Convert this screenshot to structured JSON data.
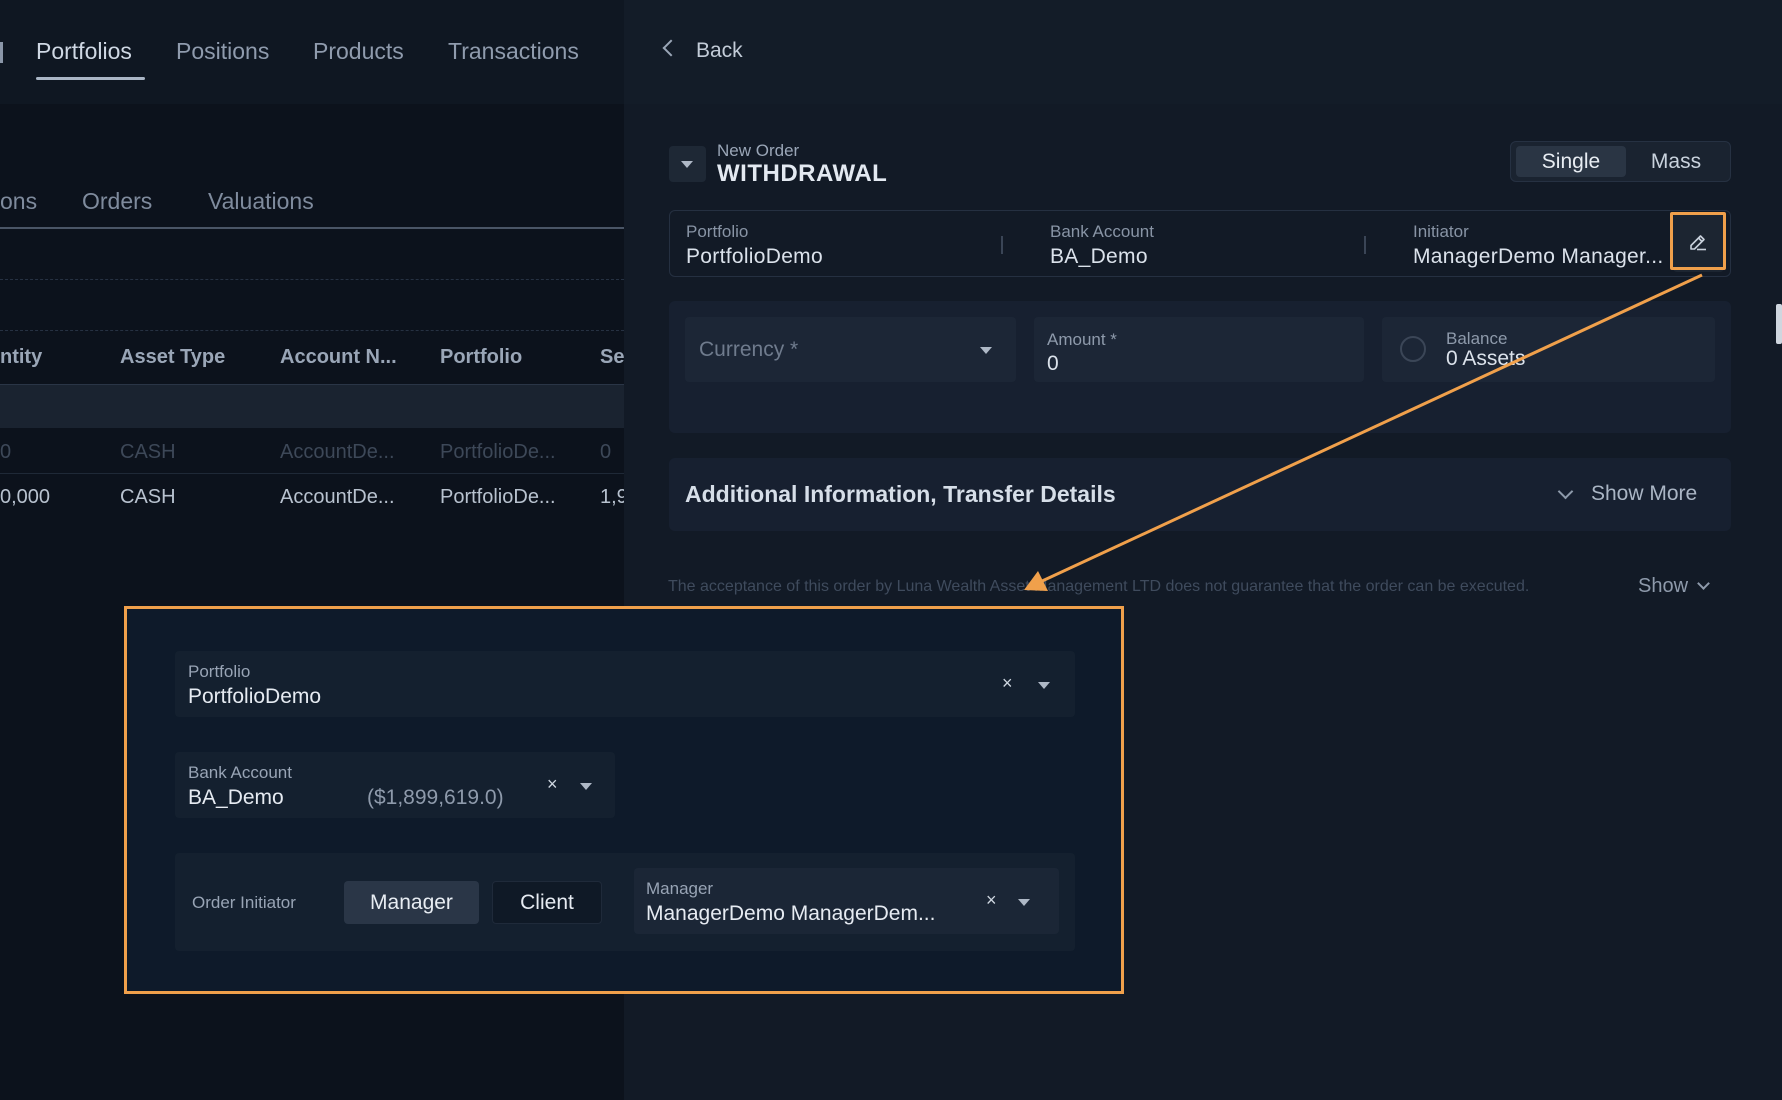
{
  "left_app": {
    "nav_tabs": [
      "Portfolios",
      "Positions",
      "Products",
      "Transactions"
    ],
    "active_nav": "Portfolios",
    "sub_tabs": [
      "ons",
      "Orders",
      "Valuations"
    ],
    "table": {
      "headers": [
        "ntity",
        "Asset Type",
        "Account N...",
        "Portfolio",
        "Se"
      ],
      "rows": [
        [
          "0",
          "CASH",
          "AccountDe...",
          "PortfolioDe...",
          "0"
        ],
        [
          "0,000",
          "CASH",
          "AccountDe...",
          "PortfolioDe...",
          "1,9"
        ]
      ]
    }
  },
  "order_panel": {
    "back_label": "Back",
    "kicker": "New Order",
    "title": "WITHDRAWAL",
    "mode_options": [
      "Single",
      "Mass"
    ],
    "active_mode": "Single",
    "summary": {
      "portfolio_label": "Portfolio",
      "portfolio_value": "PortfolioDemo",
      "bank_label": "Bank Account",
      "bank_value": "BA_Demo",
      "initiator_label": "Initiator",
      "initiator_value": "ManagerDemo Manager..."
    },
    "fields": {
      "currency_placeholder": "Currency *",
      "amount_label": "Amount *",
      "amount_value": "0",
      "balance_label": "Balance",
      "balance_value": "0 Assets"
    },
    "additional_info": {
      "title": "Additional Information, Transfer Details",
      "toggle_label": "Show More"
    },
    "disclaimer": "The acceptance of this order by Luna Wealth Asset Management LTD does not guarantee that the order can be executed.",
    "show_label": "Show"
  },
  "zoom_inset": {
    "portfolio_label": "Portfolio",
    "portfolio_value": "PortfolioDemo",
    "bank_label": "Bank Account",
    "bank_value": "BA_Demo",
    "bank_balance": "($1,899,619.0)",
    "initiator_label": "Order Initiator",
    "initiator_options": [
      "Manager",
      "Client"
    ],
    "initiator_active": "Manager",
    "manager_label": "Manager",
    "manager_value": "ManagerDemo ManagerDem...",
    "clear_glyph": "×"
  },
  "colors": {
    "accent": "#f0a04b",
    "background": "#0b111b",
    "panel": "#121a26"
  }
}
